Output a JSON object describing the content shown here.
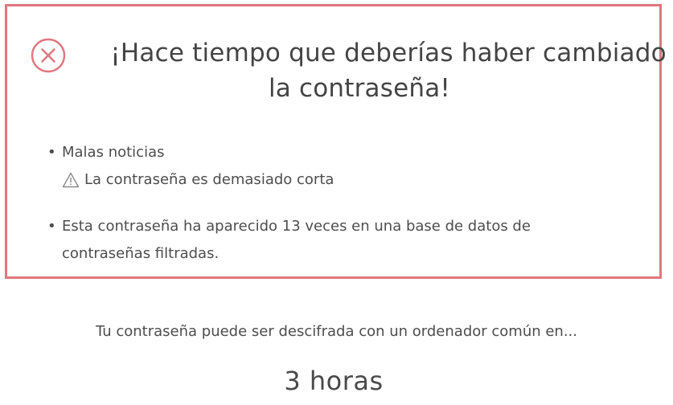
{
  "alert": {
    "title_line1": "¡Hace tiempo que deberías haber cambiado",
    "title_line2": "la contraseña!",
    "icon": "error-circle-x-icon",
    "border_color": "#e0777d"
  },
  "feedback": {
    "items": [
      {
        "text": "Malas noticias",
        "warning": "La contraseña es demasiado corta",
        "warning_icon": "warning-triangle-icon"
      },
      {
        "text_line1": "Esta contraseña ha aparecido 13 veces en una base de datos de",
        "text_line2": "contraseñas filtradas."
      }
    ]
  },
  "crack": {
    "label": "Tu contraseña puede ser descifrada con un ordenador común en...",
    "time": "3 horas"
  }
}
